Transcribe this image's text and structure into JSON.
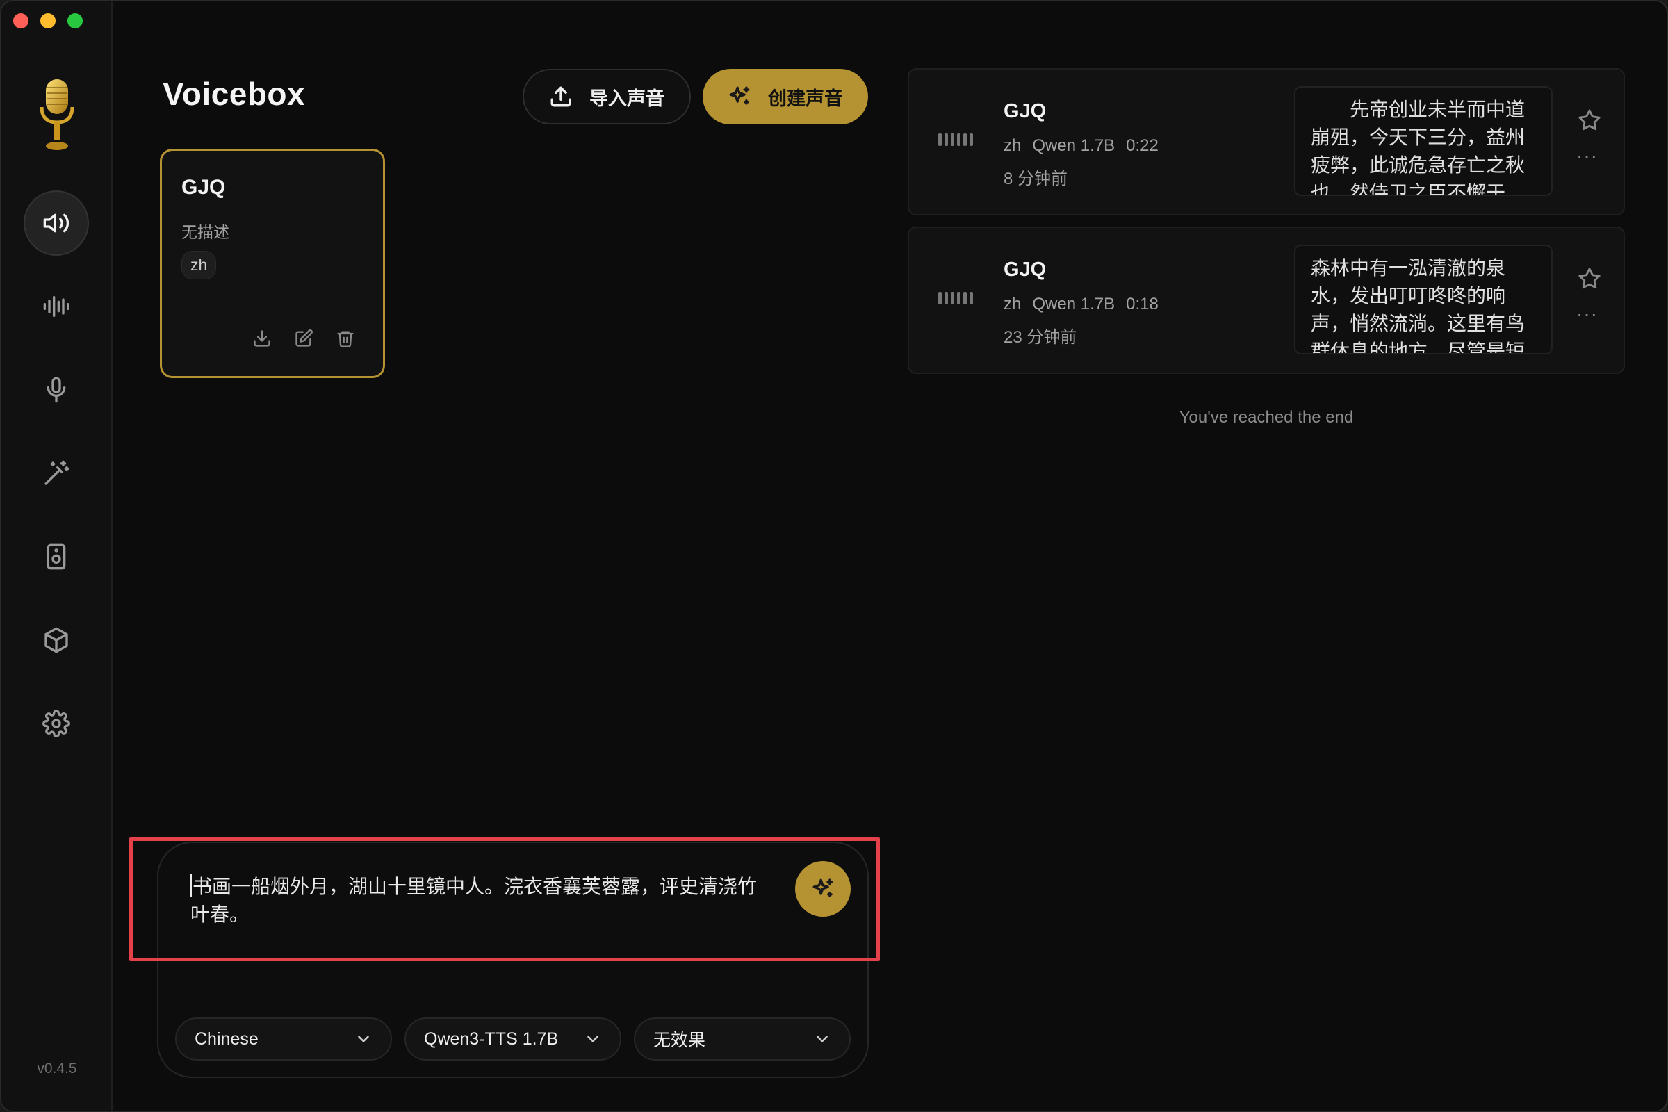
{
  "app": {
    "title": "Voicebox",
    "version": "v0.4.5"
  },
  "header": {
    "import_label": "导入声音",
    "create_label": "创建声音"
  },
  "voices": [
    {
      "name": "GJQ",
      "description": "无描述",
      "tag": "zh"
    }
  ],
  "history": [
    {
      "name": "GJQ",
      "lang": "zh",
      "model": "Qwen 1.7B",
      "duration": "0:22",
      "time": "8 分钟前",
      "text": "　　先帝创业未半而中道崩殂，今天下三分，益州疲弊，此诚危急存亡之秋也。然侍卫之臣不懈于"
    },
    {
      "name": "GJQ",
      "lang": "zh",
      "model": "Qwen 1.7B",
      "duration": "0:18",
      "time": "23 分钟前",
      "text": "森林中有一泓清澈的泉水，发出叮叮咚咚的响声，悄然流淌。这里有鸟群休息的地方，尽管是短"
    }
  ],
  "history_end": "You've reached the end",
  "composer": {
    "text": "书画一船烟外月，湖山十里镜中人。浣衣香襄芙蓉露，评史清浇竹叶春。",
    "language": "Chinese",
    "model": "Qwen3-TTS 1.7B",
    "effect": "无效果"
  },
  "colors": {
    "accent": "#b59232",
    "highlight": "#e5414b",
    "background": "#0c0c0c"
  },
  "icons": {
    "sidebar": [
      "speaker-icon",
      "waveform-icon",
      "microphone-icon",
      "magic-wand-icon",
      "speaker-device-icon",
      "box-icon",
      "gear-icon"
    ]
  }
}
